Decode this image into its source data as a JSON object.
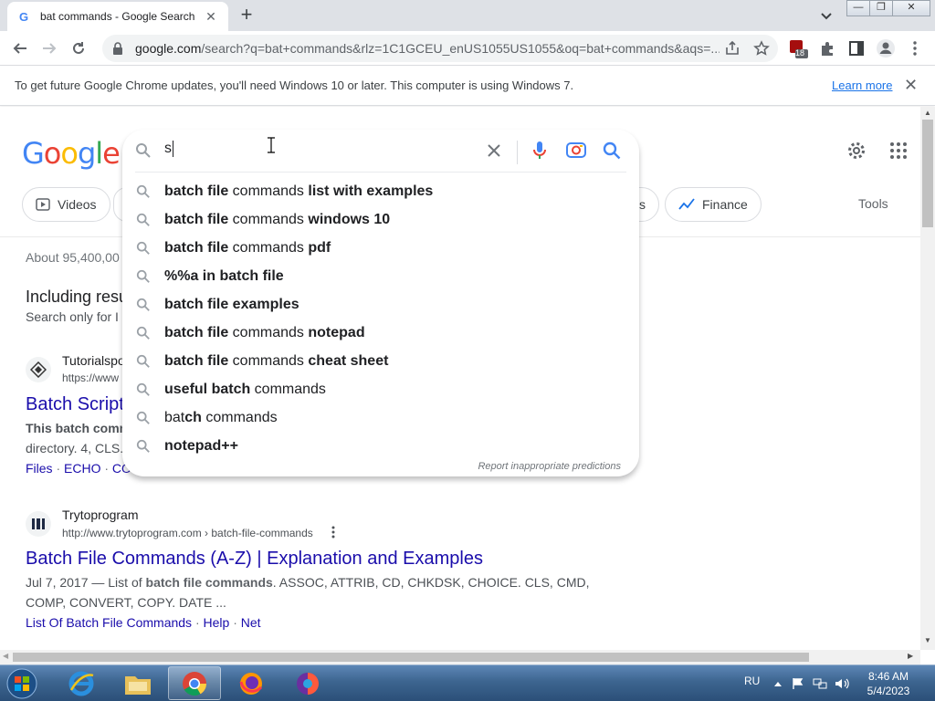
{
  "browser": {
    "tab_title": "bat commands - Google Search",
    "url_host": "google.com",
    "url_rest": "/search?q=bat+commands&rlz=1C1GCEU_enUS1055US1055&oq=bat+commands&aqs=...",
    "extension_badge": "18",
    "window_controls": {
      "minimize": "—",
      "maximize": "❐",
      "close": "✕"
    }
  },
  "infobar": {
    "message": "To get future Google Chrome updates, you'll need Windows 10 or later. This computer is using Windows 7.",
    "link": "Learn more"
  },
  "google": {
    "logo": [
      "G",
      "o",
      "o",
      "g",
      "l",
      "e"
    ],
    "logo_colors": [
      "#4285f4",
      "#ea4335",
      "#fbbc05",
      "#4285f4",
      "#34a853",
      "#ea4335"
    ],
    "search_value": "s",
    "chips": [
      "Videos",
      "Finance",
      "s"
    ],
    "tools": "Tools",
    "stats_prefix": "About 95,400,00",
    "including": "Including resu",
    "search_only": "Search only for I"
  },
  "suggestions": [
    [
      {
        "t": "batch file",
        "b": true
      },
      {
        "t": " commands ",
        "b": false
      },
      {
        "t": "list with examples",
        "b": true
      }
    ],
    [
      {
        "t": "batch file",
        "b": true
      },
      {
        "t": " commands ",
        "b": false
      },
      {
        "t": "windows 10",
        "b": true
      }
    ],
    [
      {
        "t": "batch file",
        "b": true
      },
      {
        "t": " commands ",
        "b": false
      },
      {
        "t": "pdf",
        "b": true
      }
    ],
    [
      {
        "t": "%%a in batch file",
        "b": true
      }
    ],
    [
      {
        "t": "batch file examples",
        "b": true
      }
    ],
    [
      {
        "t": "batch file",
        "b": true
      },
      {
        "t": " commands ",
        "b": false
      },
      {
        "t": "notepad",
        "b": true
      }
    ],
    [
      {
        "t": "batch file",
        "b": true
      },
      {
        "t": " commands ",
        "b": false
      },
      {
        "t": "cheat sheet",
        "b": true
      }
    ],
    [
      {
        "t": "useful batch",
        "b": true
      },
      {
        "t": " commands",
        "b": false
      }
    ],
    [
      {
        "t": "bat",
        "b": false
      },
      {
        "t": "ch",
        "b": true
      },
      {
        "t": " commands",
        "b": false
      }
    ],
    [
      {
        "t": "notepad++",
        "b": true
      }
    ]
  ],
  "report_text": "Report inappropriate predictions",
  "results": [
    {
      "site": "Tutorialspo",
      "url": "https://www",
      "title": "Batch Script",
      "snippet_bold": "This batch comm",
      "snippet_line2": "directory. 4, CLS.",
      "links": [
        "Files",
        "ECHO",
        "COI"
      ]
    },
    {
      "site": "Trytoprogram",
      "url": "http://www.trytoprogram.com › batch-file-commands",
      "title": "Batch File Commands (A-Z) | Explanation and Examples",
      "snippet_date": "Jul 7, 2017 — List of ",
      "snippet_bold": "batch file commands",
      "snippet_rest": ". ASSOC, ATTRIB, CD, CHKDSK, CHOICE. CLS, CMD,",
      "snippet_line2": "COMP, CONVERT, COPY. DATE ...",
      "links": [
        "List Of Batch File Commands",
        "Help",
        "Net"
      ]
    }
  ],
  "taskbar": {
    "lang": "RU",
    "time": "8:46 AM",
    "date": "5/4/2023"
  }
}
